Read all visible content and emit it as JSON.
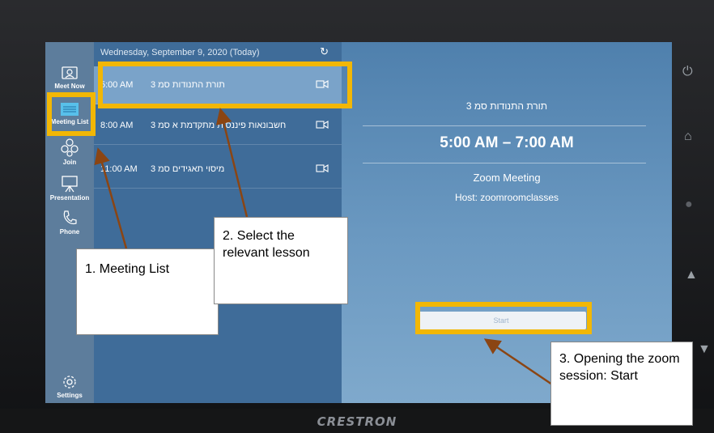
{
  "device": {
    "brand": "CRESTRON"
  },
  "nav": {
    "items": [
      {
        "label": "Meet Now",
        "icon": "meet-now-icon"
      },
      {
        "label": "Meeting List",
        "icon": "meeting-list-icon"
      },
      {
        "label": "Join",
        "icon": "join-icon"
      },
      {
        "label": "Presentation",
        "icon": "presentation-icon"
      },
      {
        "label": "Phone",
        "icon": "phone-icon"
      }
    ],
    "settings_label": "Settings"
  },
  "meeting_list": {
    "date_header": "Wednesday, September 9, 2020 (Today)",
    "meetings": [
      {
        "time": "5:00 AM",
        "title": "תורת התנודות סמ 3"
      },
      {
        "time": "8:00 AM",
        "title": "חשבונאות פיננסית מתקדמת א סמ 3"
      },
      {
        "time": "11:00 AM",
        "title": "מיסוי תאגידים סמ 3"
      }
    ]
  },
  "detail": {
    "title": "תורת התנודות סמ 3",
    "time_range": "5:00 AM – 7:00 AM",
    "type": "Zoom Meeting",
    "host": "Host: zoomroomclasses",
    "start_label": "Start"
  },
  "annotations": {
    "step1": "1. Meeting List",
    "step2": "2. Select the relevant lesson",
    "step3": "3. Opening the zoom session: Start"
  },
  "colors": {
    "highlight": "#f2b705",
    "arrow": "#8b4513"
  }
}
